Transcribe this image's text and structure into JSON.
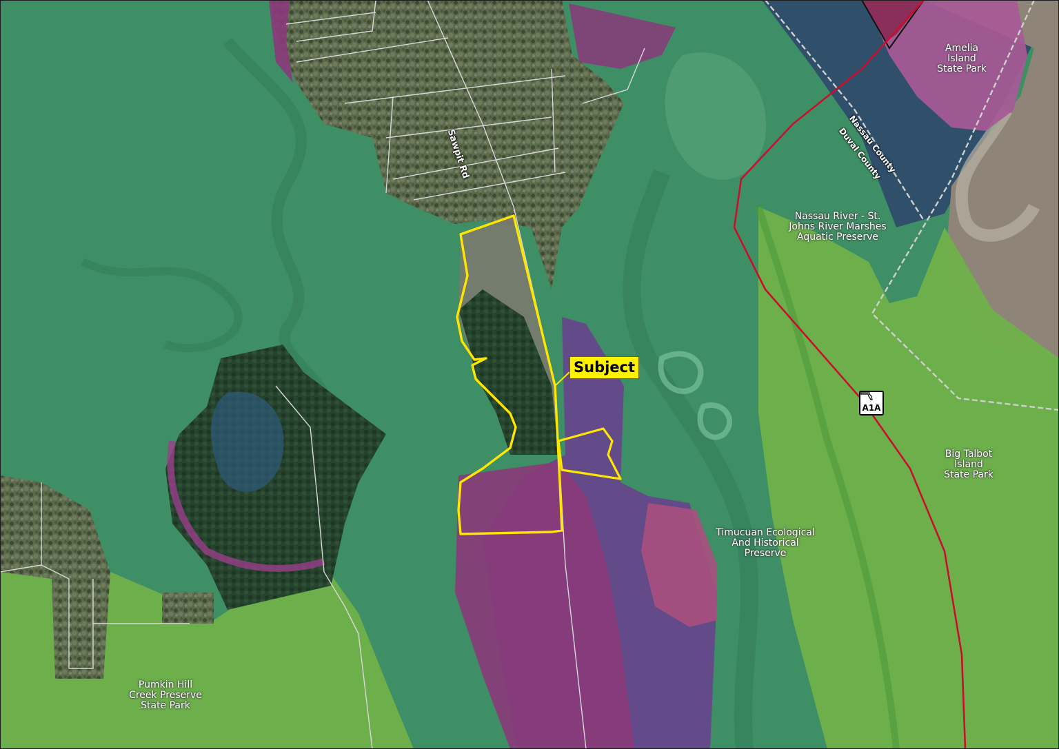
{
  "labels": {
    "subject": "Subject",
    "road_sawpit": "Sawpit Rd",
    "county_nassau": "Nassau County",
    "county_duval": "Duval County",
    "highway_shield": "A1A",
    "amelia": [
      "Amelia",
      "Island",
      "State Park"
    ],
    "nassau_river": [
      "Nassau River - St.",
      "Johns River Marshes",
      "Aquatic Preserve"
    ],
    "big_talbot": [
      "Big Talbot",
      "Island",
      "State Park"
    ],
    "timucuan": [
      "Timucuan Ecological",
      "And Historical",
      "Preserve"
    ],
    "pumkin_hill": [
      "Pumkin Hill",
      "Creek Preserve",
      "State Park"
    ]
  },
  "colors": {
    "marsh_green": "#3f8f66",
    "park_light_green": "#6fb14a",
    "preserve_magenta": "#8a3a7a",
    "preserve_purple": "#6a3f8f",
    "water_navy": "#2e4a6a",
    "subject_yellow": "#ffe600",
    "highway_red": "#c8102e",
    "county_line": "#c8c8c8"
  },
  "icons": {
    "highway_shield": "florida-state-outline-icon"
  }
}
